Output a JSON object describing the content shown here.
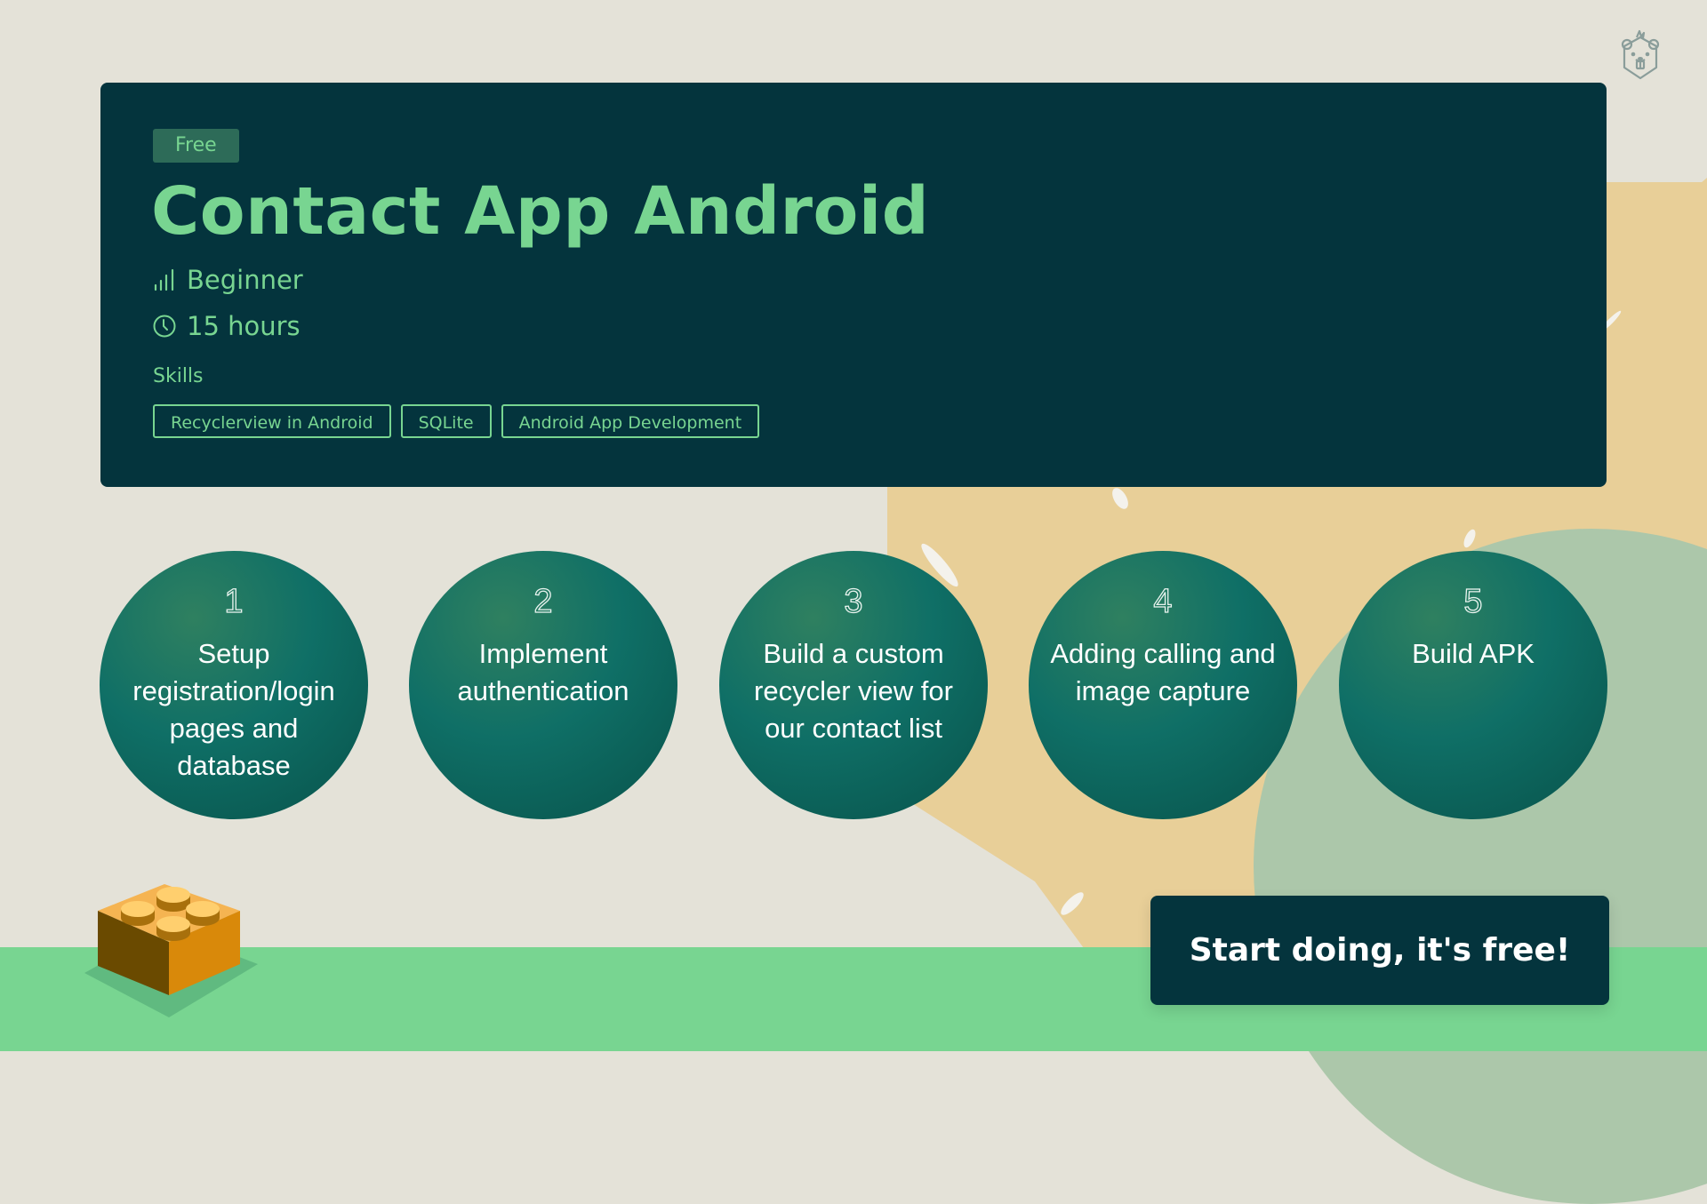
{
  "course": {
    "badge": "Free",
    "title": "Contact App Android",
    "level": "Beginner",
    "duration": "15 hours",
    "skills_label": "Skills",
    "skills": [
      "Recyclerview in Android",
      "SQLite",
      "Android App Development"
    ]
  },
  "steps": [
    {
      "number": "1",
      "label": "Setup registration/login pages and database"
    },
    {
      "number": "2",
      "label": "Implement authentication"
    },
    {
      "number": "3",
      "label": "Build a custom recycler view for our contact list"
    },
    {
      "number": "4",
      "label": "Adding calling and image capture"
    },
    {
      "number": "5",
      "label": "Build APK"
    }
  ],
  "cta": {
    "label": "Start doing, it's free!"
  },
  "icons": {
    "logo": "beaver-logo-icon",
    "level": "signal-bars-icon",
    "duration": "clock-icon",
    "decoration": "lego-brick-icon"
  },
  "colors": {
    "background": "#e4e2d8",
    "card": "#04343d",
    "accent_green": "#78d591",
    "badge_bg": "#2d6b58",
    "step_circle": "#0f6f66",
    "yellow_shape": "#e8cf98",
    "sage_shape": "#acc7aa",
    "lego_orange": "#f0a53c"
  }
}
